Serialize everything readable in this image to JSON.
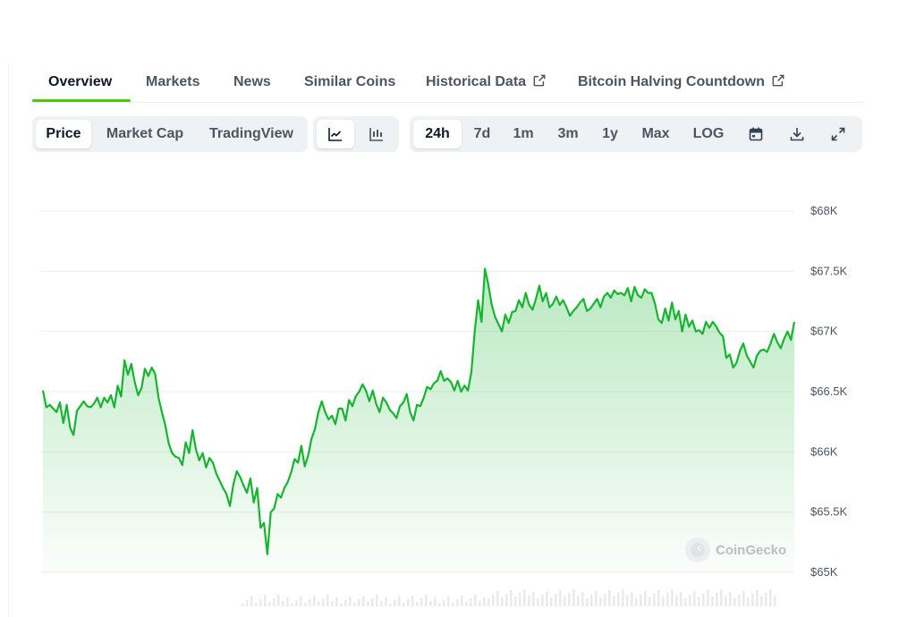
{
  "tabs": [
    {
      "label": "Overview",
      "active": true
    },
    {
      "label": "Markets"
    },
    {
      "label": "News"
    },
    {
      "label": "Similar Coins"
    },
    {
      "label": "Historical Data",
      "external": true
    },
    {
      "label": "Bitcoin Halving Countdown",
      "external": true
    }
  ],
  "toolbar": {
    "view_modes": [
      "Price",
      "Market Cap",
      "TradingView"
    ],
    "chart_styles": [
      "line-chart-icon",
      "candlestick-chart-icon"
    ],
    "ranges": [
      "24h",
      "7d",
      "1m",
      "3m",
      "1y",
      "Max",
      "LOG"
    ],
    "selected_view": "Price",
    "selected_style": "line-chart-icon",
    "selected_range": "24h",
    "actions": [
      "calendar-icon",
      "download-icon",
      "fullscreen-icon"
    ]
  },
  "watermark": "CoinGecko",
  "colors": {
    "line": "#16b52f",
    "accent": "#4bcc00",
    "grid": "#eceef1"
  },
  "chart_data": {
    "type": "area",
    "ylim": [
      65000,
      68000
    ],
    "y_ticks": [
      65000,
      65500,
      66000,
      66500,
      67000,
      67500,
      68000
    ],
    "y_tick_labels": [
      "$65K",
      "$65.5K",
      "$66K",
      "$66.5K",
      "$67K",
      "$67.5K",
      "$68K"
    ],
    "grid": true,
    "series": [
      {
        "values": [
          66510,
          66370,
          66390,
          66360,
          66330,
          66410,
          66240,
          66390,
          66200,
          66140,
          66340,
          66380,
          66420,
          66380,
          66370,
          66400,
          66450,
          66370,
          66450,
          66410,
          66470,
          66370,
          66550,
          66460,
          66760,
          66640,
          66730,
          66580,
          66470,
          66530,
          66690,
          66630,
          66700,
          66650,
          66450,
          66330,
          66220,
          66070,
          65990,
          65960,
          65950,
          65890,
          66080,
          65990,
          66180,
          66020,
          65930,
          65990,
          65870,
          65950,
          65910,
          65820,
          65760,
          65700,
          65650,
          65550,
          65730,
          65840,
          65790,
          65720,
          65660,
          65780,
          65580,
          65700,
          65370,
          65410,
          65150,
          65500,
          65530,
          65650,
          65620,
          65700,
          65750,
          65830,
          65940,
          65910,
          66050,
          65880,
          65970,
          66110,
          66190,
          66330,
          66420,
          66330,
          66270,
          66300,
          66230,
          66360,
          66360,
          66260,
          66430,
          66380,
          66460,
          66500,
          66560,
          66510,
          66420,
          66510,
          66400,
          66330,
          66450,
          66410,
          66350,
          66320,
          66280,
          66380,
          66410,
          66480,
          66330,
          66260,
          66390,
          66380,
          66450,
          66540,
          66520,
          66570,
          66590,
          66670,
          66590,
          66610,
          66580,
          66510,
          66590,
          66500,
          66550,
          66510,
          66660,
          67000,
          67260,
          67080,
          67520,
          67390,
          67220,
          67120,
          67060,
          67000,
          67140,
          67070,
          67160,
          67170,
          67260,
          67200,
          67320,
          67220,
          67180,
          67270,
          67380,
          67250,
          67320,
          67200,
          67230,
          67290,
          67220,
          67260,
          67200,
          67130,
          67170,
          67200,
          67240,
          67270,
          67170,
          67190,
          67230,
          67270,
          67200,
          67290,
          67320,
          67280,
          67340,
          67310,
          67320,
          67300,
          67360,
          67250,
          67370,
          67300,
          67280,
          67350,
          67320,
          67320,
          67230,
          67100,
          67070,
          67190,
          67090,
          67240,
          67100,
          67170,
          67000,
          67140,
          67040,
          67090,
          67000,
          67010,
          66980,
          67080,
          67030,
          67080,
          67040,
          66990,
          66960,
          66780,
          66810,
          66700,
          66740,
          66840,
          66900,
          66800,
          66750,
          66700,
          66800,
          66840,
          66850,
          66830,
          66900,
          66980,
          66910,
          66860,
          66940,
          67000,
          66930,
          67080
        ],
        "color": "#16b52f"
      }
    ]
  }
}
